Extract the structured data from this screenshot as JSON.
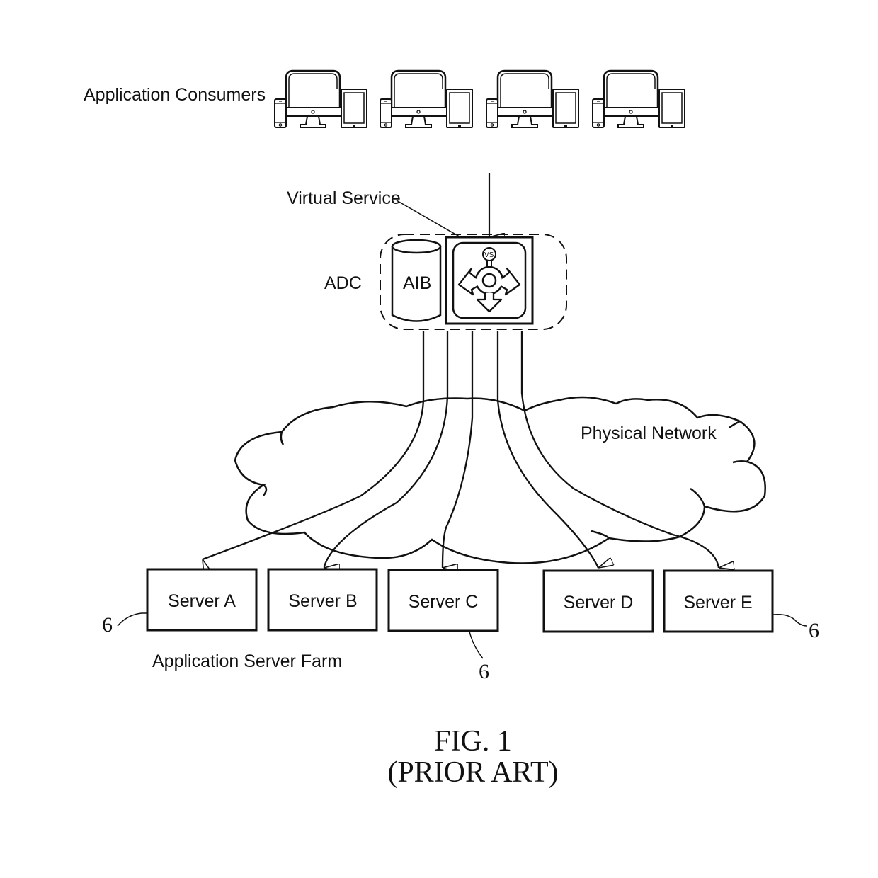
{
  "figure": {
    "title": "FIG. 1",
    "subtitle": "(PRIOR ART)"
  },
  "labels": {
    "application_consumers": "Application Consumers",
    "virtual_service": "Virtual Service",
    "adc": "ADC",
    "aib": "AIB",
    "vs_badge": "VS",
    "physical_network": "Physical Network",
    "application_server_farm": "Application Server Farm"
  },
  "consumer_groups": [
    {
      "devices": [
        "smartphone",
        "desktop-monitor",
        "tablet"
      ]
    },
    {
      "devices": [
        "smartphone",
        "desktop-monitor",
        "tablet"
      ]
    },
    {
      "devices": [
        "smartphone",
        "desktop-monitor",
        "tablet"
      ]
    },
    {
      "devices": [
        "smartphone",
        "desktop-monitor",
        "tablet"
      ]
    }
  ],
  "servers": [
    {
      "name": "Server A",
      "ref": "6"
    },
    {
      "name": "Server B",
      "ref": ""
    },
    {
      "name": "Server C",
      "ref": "6"
    },
    {
      "name": "Server D",
      "ref": ""
    },
    {
      "name": "Server E",
      "ref": "6"
    }
  ],
  "reference_numerals": {
    "server_a": "6",
    "server_c": "6",
    "server_e": "6"
  },
  "colors": {
    "ink": "#111111",
    "background": "#ffffff"
  }
}
